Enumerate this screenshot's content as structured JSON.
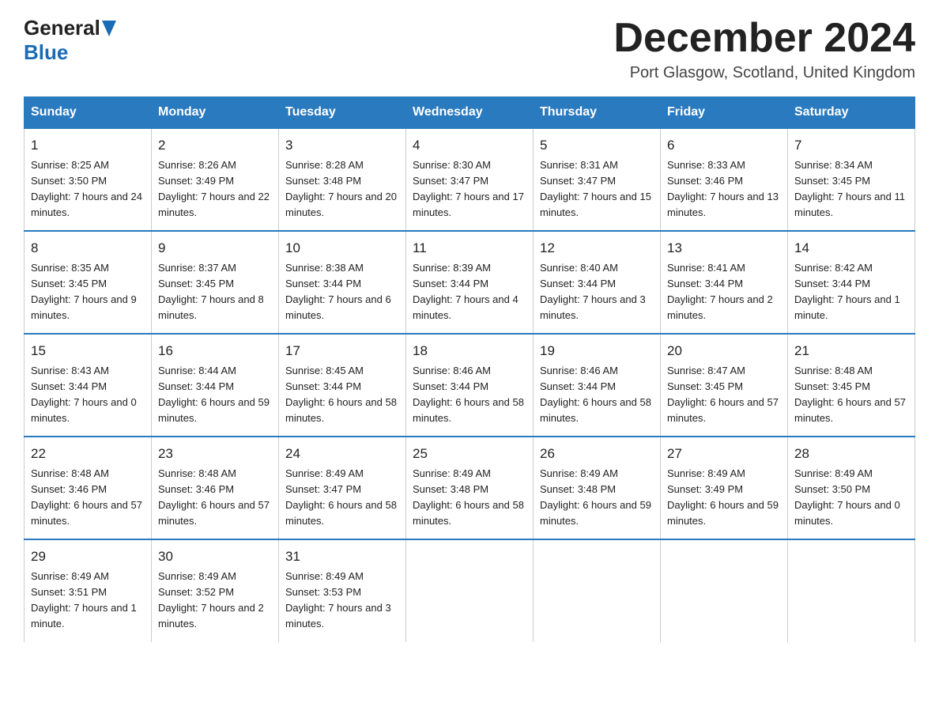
{
  "header": {
    "logo_general": "General",
    "logo_blue": "Blue",
    "month_title": "December 2024",
    "location": "Port Glasgow, Scotland, United Kingdom"
  },
  "weekdays": [
    "Sunday",
    "Monday",
    "Tuesday",
    "Wednesday",
    "Thursday",
    "Friday",
    "Saturday"
  ],
  "weeks": [
    [
      {
        "day": "1",
        "sunrise": "8:25 AM",
        "sunset": "3:50 PM",
        "daylight": "7 hours and 24 minutes."
      },
      {
        "day": "2",
        "sunrise": "8:26 AM",
        "sunset": "3:49 PM",
        "daylight": "7 hours and 22 minutes."
      },
      {
        "day": "3",
        "sunrise": "8:28 AM",
        "sunset": "3:48 PM",
        "daylight": "7 hours and 20 minutes."
      },
      {
        "day": "4",
        "sunrise": "8:30 AM",
        "sunset": "3:47 PM",
        "daylight": "7 hours and 17 minutes."
      },
      {
        "day": "5",
        "sunrise": "8:31 AM",
        "sunset": "3:47 PM",
        "daylight": "7 hours and 15 minutes."
      },
      {
        "day": "6",
        "sunrise": "8:33 AM",
        "sunset": "3:46 PM",
        "daylight": "7 hours and 13 minutes."
      },
      {
        "day": "7",
        "sunrise": "8:34 AM",
        "sunset": "3:45 PM",
        "daylight": "7 hours and 11 minutes."
      }
    ],
    [
      {
        "day": "8",
        "sunrise": "8:35 AM",
        "sunset": "3:45 PM",
        "daylight": "7 hours and 9 minutes."
      },
      {
        "day": "9",
        "sunrise": "8:37 AM",
        "sunset": "3:45 PM",
        "daylight": "7 hours and 8 minutes."
      },
      {
        "day": "10",
        "sunrise": "8:38 AM",
        "sunset": "3:44 PM",
        "daylight": "7 hours and 6 minutes."
      },
      {
        "day": "11",
        "sunrise": "8:39 AM",
        "sunset": "3:44 PM",
        "daylight": "7 hours and 4 minutes."
      },
      {
        "day": "12",
        "sunrise": "8:40 AM",
        "sunset": "3:44 PM",
        "daylight": "7 hours and 3 minutes."
      },
      {
        "day": "13",
        "sunrise": "8:41 AM",
        "sunset": "3:44 PM",
        "daylight": "7 hours and 2 minutes."
      },
      {
        "day": "14",
        "sunrise": "8:42 AM",
        "sunset": "3:44 PM",
        "daylight": "7 hours and 1 minute."
      }
    ],
    [
      {
        "day": "15",
        "sunrise": "8:43 AM",
        "sunset": "3:44 PM",
        "daylight": "7 hours and 0 minutes."
      },
      {
        "day": "16",
        "sunrise": "8:44 AM",
        "sunset": "3:44 PM",
        "daylight": "6 hours and 59 minutes."
      },
      {
        "day": "17",
        "sunrise": "8:45 AM",
        "sunset": "3:44 PM",
        "daylight": "6 hours and 58 minutes."
      },
      {
        "day": "18",
        "sunrise": "8:46 AM",
        "sunset": "3:44 PM",
        "daylight": "6 hours and 58 minutes."
      },
      {
        "day": "19",
        "sunrise": "8:46 AM",
        "sunset": "3:44 PM",
        "daylight": "6 hours and 58 minutes."
      },
      {
        "day": "20",
        "sunrise": "8:47 AM",
        "sunset": "3:45 PM",
        "daylight": "6 hours and 57 minutes."
      },
      {
        "day": "21",
        "sunrise": "8:48 AM",
        "sunset": "3:45 PM",
        "daylight": "6 hours and 57 minutes."
      }
    ],
    [
      {
        "day": "22",
        "sunrise": "8:48 AM",
        "sunset": "3:46 PM",
        "daylight": "6 hours and 57 minutes."
      },
      {
        "day": "23",
        "sunrise": "8:48 AM",
        "sunset": "3:46 PM",
        "daylight": "6 hours and 57 minutes."
      },
      {
        "day": "24",
        "sunrise": "8:49 AM",
        "sunset": "3:47 PM",
        "daylight": "6 hours and 58 minutes."
      },
      {
        "day": "25",
        "sunrise": "8:49 AM",
        "sunset": "3:48 PM",
        "daylight": "6 hours and 58 minutes."
      },
      {
        "day": "26",
        "sunrise": "8:49 AM",
        "sunset": "3:48 PM",
        "daylight": "6 hours and 59 minutes."
      },
      {
        "day": "27",
        "sunrise": "8:49 AM",
        "sunset": "3:49 PM",
        "daylight": "6 hours and 59 minutes."
      },
      {
        "day": "28",
        "sunrise": "8:49 AM",
        "sunset": "3:50 PM",
        "daylight": "7 hours and 0 minutes."
      }
    ],
    [
      {
        "day": "29",
        "sunrise": "8:49 AM",
        "sunset": "3:51 PM",
        "daylight": "7 hours and 1 minute."
      },
      {
        "day": "30",
        "sunrise": "8:49 AM",
        "sunset": "3:52 PM",
        "daylight": "7 hours and 2 minutes."
      },
      {
        "day": "31",
        "sunrise": "8:49 AM",
        "sunset": "3:53 PM",
        "daylight": "7 hours and 3 minutes."
      },
      null,
      null,
      null,
      null
    ]
  ]
}
